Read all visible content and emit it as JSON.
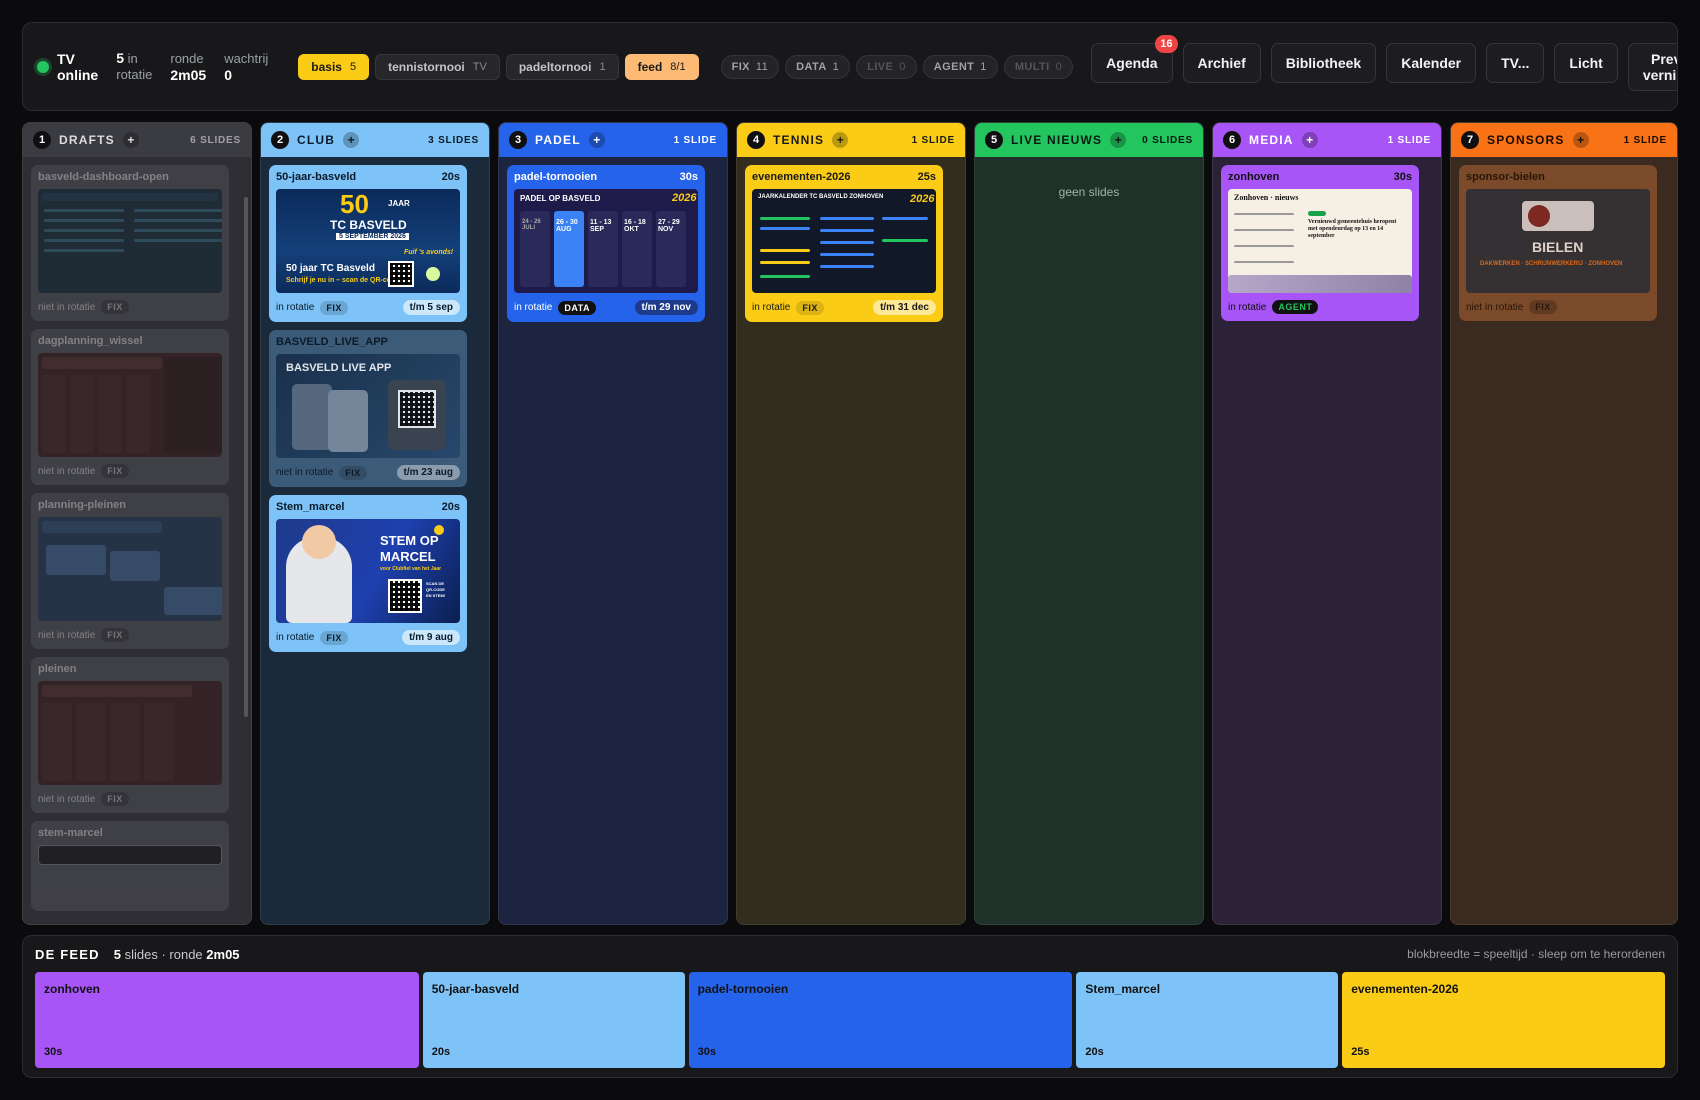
{
  "status": {
    "line1": "TV",
    "line2": "online"
  },
  "stats": {
    "rotation_value": "5",
    "rotation_label_1": "in",
    "rotation_label_2": "rotatie",
    "round_label": "ronde",
    "round_value": "2m05",
    "queue_label": "wachtrij",
    "queue_value": "0"
  },
  "playlists": [
    {
      "label": "basis",
      "count": "5"
    },
    {
      "label": "tennistornooi",
      "count": "TV"
    },
    {
      "label": "padeltornooi",
      "count": "1"
    },
    {
      "label": "feed",
      "count": "8/1"
    }
  ],
  "filters": [
    {
      "label": "FIX",
      "count": "11"
    },
    {
      "label": "DATA",
      "count": "1"
    },
    {
      "label": "LIVE",
      "count": "0"
    },
    {
      "label": "AGENT",
      "count": "1"
    },
    {
      "label": "MULTI",
      "count": "0"
    }
  ],
  "nav": {
    "agenda": "Agenda",
    "agenda_badge": "16",
    "archief": "Archief",
    "bibliotheek": "Bibliotheek",
    "kalender": "Kalender",
    "tv": "TV...",
    "licht": "Licht",
    "previews_1": "Previews",
    "previews_2": "vernieuwen",
    "cut": "Ve"
  },
  "colors": {
    "drafts": "#3b3b42",
    "club": "#7dc3f7",
    "padel": "#2563eb",
    "tennis": "#facc15",
    "live": "#22c55e",
    "media": "#a855f7",
    "sponsors": "#f97316"
  },
  "columns": [
    {
      "num": "1",
      "title": "DRAFTS",
      "count": "6 SLIDES",
      "cards": [
        {
          "name": "basveld-dashboard-open",
          "status": "niet in rotatie",
          "tag": "FIX"
        },
        {
          "name": "dagplanning_wissel",
          "status": "niet in rotatie",
          "tag": "FIX"
        },
        {
          "name": "planning-pleinen",
          "status": "niet in rotatie",
          "tag": "FIX"
        },
        {
          "name": "pleinen",
          "status": "niet in rotatie",
          "tag": "FIX"
        },
        {
          "name": "stem-marcel"
        }
      ]
    },
    {
      "num": "2",
      "title": "CLUB",
      "count": "3 SLIDES",
      "cards": [
        {
          "name": "50-jaar-basveld",
          "dur": "20s",
          "status": "in rotatie",
          "tag": "FIX",
          "until": "t/m 5 sep",
          "thumb": {
            "big": "50",
            "sub": "JAAR",
            "title": "TC BASVELD",
            "date": "5 SEPTEMBER 2026",
            "line1": "50 jaar TC Basveld",
            "line2": "Schrijf je nu in – scan de QR-code",
            "small": "Fuif 's avonds!"
          }
        },
        {
          "name": "BASVELD_LIVE_APP",
          "status": "niet in rotatie",
          "tag": "FIX",
          "until": "t/m 23 aug",
          "thumb": {
            "title": "BASVELD LIVE APP"
          }
        },
        {
          "name": "Stem_marcel",
          "dur": "20s",
          "status": "in rotatie",
          "tag": "FIX",
          "until": "t/m 9 aug",
          "thumb": {
            "title1": "STEM OP",
            "title2": "MARCEL",
            "sub": "voor Clubfiel van het Jaar",
            "scan": "SCAN DE QR-CODE EN STEM!"
          }
        }
      ]
    },
    {
      "num": "3",
      "title": "PADEL",
      "count": "1 SLIDE",
      "cards": [
        {
          "name": "padel-tornooien",
          "dur": "30s",
          "status": "in rotatie",
          "tag": "DATA",
          "until": "t/m 29 nov",
          "thumb": {
            "title": "PADEL OP BASVELD",
            "year": "2026",
            "d1": "24 - 26 JULI",
            "d2": "26 - 30 AUG",
            "d3": "11 - 13 SEP",
            "d4": "16 - 18 OKT",
            "d5": "27 - 29 NOV"
          }
        }
      ]
    },
    {
      "num": "4",
      "title": "TENNIS",
      "count": "1 SLIDE",
      "cards": [
        {
          "name": "evenementen-2026",
          "dur": "25s",
          "status": "in rotatie",
          "tag": "FIX",
          "until": "t/m 31 dec",
          "thumb": {
            "title": "JAARKALENDER TC BASVELD ZONHOVEN",
            "year": "2026"
          }
        }
      ]
    },
    {
      "num": "5",
      "title": "LIVE NIEUWS",
      "count": "0 SLIDES",
      "empty": "geen slides",
      "cards": []
    },
    {
      "num": "6",
      "title": "MEDIA",
      "count": "1 SLIDE",
      "cards": [
        {
          "name": "zonhoven",
          "dur": "30s",
          "status": "in rotatie",
          "tag": "AGENT",
          "thumb": {
            "title": "Zonhoven · nieuws",
            "headline": "Vernieuwd gemeentehuis heropent met opendeurdag op 13 en 14 september"
          }
        }
      ]
    },
    {
      "num": "7",
      "title": "SPONSORS",
      "count": "1 SLIDE",
      "cards": [
        {
          "name": "sponsor-bielen",
          "status": "niet in rotatie",
          "tag": "FIX",
          "thumb": {
            "title": "BIELEN",
            "sub": "DAKWERKEN · SCHRIJNWERKERIJ · ZONHOVEN"
          }
        }
      ]
    }
  ],
  "feed": {
    "title": "DE FEED",
    "count": "5",
    "meta_mid": "slides · ronde",
    "round": "2m05",
    "hint": "blokbreedte = speeltijd · sleep om te herordenen",
    "segments": [
      {
        "name": "zonhoven",
        "dur": "30s",
        "color": "#a855f7"
      },
      {
        "name": "50-jaar-basveld",
        "dur": "20s",
        "color": "#7dc3f7"
      },
      {
        "name": "padel-tornooien",
        "dur": "30s",
        "color": "#2563eb"
      },
      {
        "name": "Stem_marcel",
        "dur": "20s",
        "color": "#7dc3f7"
      },
      {
        "name": "evenementen-2026",
        "dur": "25s",
        "color": "#facc15"
      }
    ]
  }
}
